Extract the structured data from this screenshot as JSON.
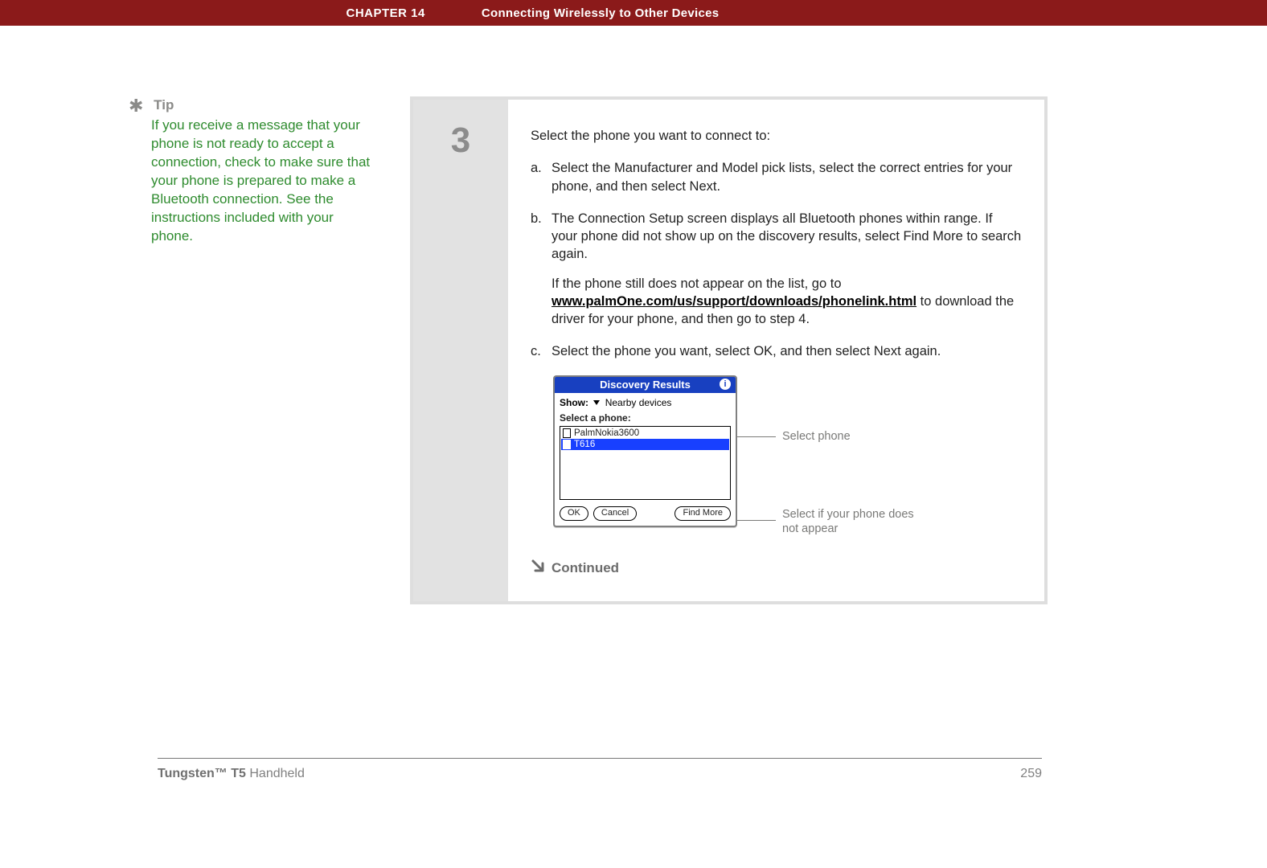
{
  "header": {
    "chapter": "CHAPTER 14",
    "title": "Connecting Wirelessly to Other Devices"
  },
  "sidebar": {
    "tip_label": "Tip",
    "tip_text": "If you receive a message that your phone is not ready to accept a connection, check to make sure that your phone is prepared to make a Bluetooth connection. See the instructions included with your phone."
  },
  "step": {
    "number": "3",
    "lead": "Select the phone you want to connect to:",
    "items": [
      {
        "letter": "a.",
        "text": "Select the Manufacturer and Model pick lists, select the correct entries for your phone, and then select Next."
      },
      {
        "letter": "b.",
        "text": "The Connection Setup screen displays all Bluetooth phones within range. If your phone did not show up on the discovery results, select Find More to search again.",
        "extra_prefix": "If the phone still does not appear on the list, go to ",
        "extra_link": "www.palmOne.com/us/support/downloads/phonelink.html",
        "extra_suffix": " to download the driver for your phone, and then go to step 4."
      },
      {
        "letter": "c.",
        "text": "Select the phone you want, select OK, and then select Next again."
      }
    ],
    "continued": "Continued"
  },
  "device": {
    "title": "Discovery Results",
    "show_label": "Show:",
    "show_value": "Nearby devices",
    "select_label": "Select a phone:",
    "phones": [
      "PalmNokia3600",
      "T616"
    ],
    "selected_index": 1,
    "buttons": {
      "ok": "OK",
      "cancel": "Cancel",
      "find_more": "Find More"
    }
  },
  "callouts": {
    "select_phone": "Select phone",
    "not_appear": "Select if your phone does not appear"
  },
  "footer": {
    "product_bold": "Tungsten™ T5",
    "product_rest": " Handheld",
    "page": "259"
  }
}
